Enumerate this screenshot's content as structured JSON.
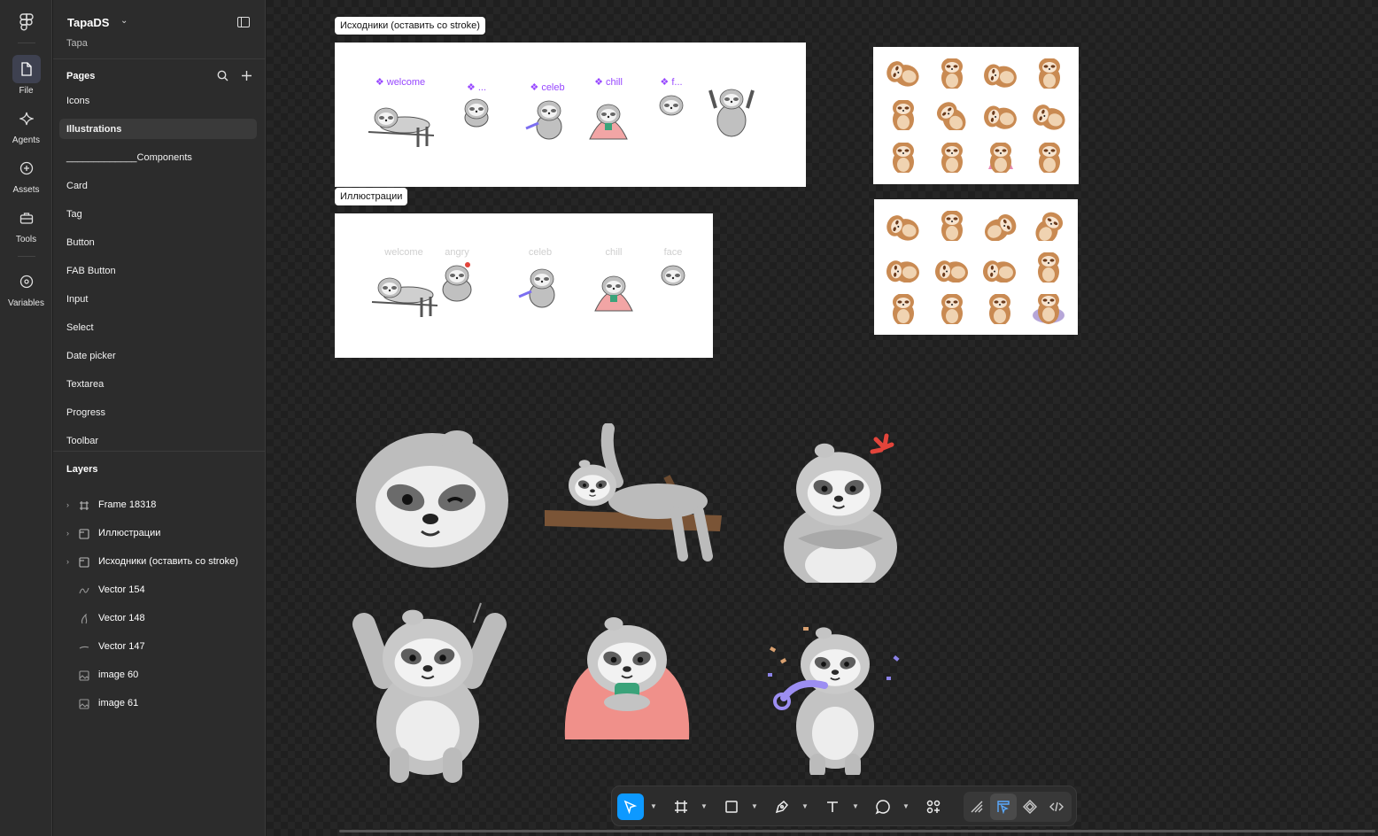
{
  "rail": {
    "items": [
      {
        "label": "File",
        "icon": "file-icon"
      },
      {
        "label": "Agents",
        "icon": "sparkle-icon"
      },
      {
        "label": "Assets",
        "icon": "plus-circle-icon"
      },
      {
        "label": "Tools",
        "icon": "toolbox-icon"
      },
      {
        "label": "Variables",
        "icon": "variables-icon"
      }
    ]
  },
  "project": {
    "title": "TapaDS",
    "subtitle": "Tapa"
  },
  "pages": {
    "title": "Pages",
    "items": [
      "Icons",
      "Illustrations",
      "_____________Components",
      "Card",
      "Tag",
      "Button",
      "FAB Button",
      "Input",
      "Select",
      "Date picker",
      "Textarea",
      "Progress",
      "Toolbar"
    ],
    "selected": "Illustrations"
  },
  "layers": {
    "title": "Layers",
    "items": [
      {
        "name": "Frame 18318",
        "type": "frame",
        "expandable": true
      },
      {
        "name": "Иллюстрации",
        "type": "section",
        "expandable": true
      },
      {
        "name": "Исходники (оставить со stroke)",
        "type": "section",
        "expandable": true
      },
      {
        "name": "Vector 154",
        "type": "vector",
        "expandable": false
      },
      {
        "name": "Vector 148",
        "type": "vector",
        "expandable": false
      },
      {
        "name": "Vector 147",
        "type": "vector",
        "expandable": false
      },
      {
        "name": "image 60",
        "type": "image",
        "expandable": false
      },
      {
        "name": "image 61",
        "type": "image",
        "expandable": false
      }
    ]
  },
  "canvas": {
    "frame_sources": {
      "label": "Исходники (оставить со stroke)",
      "items": [
        "welcome",
        "...",
        "celeb",
        "chill",
        "f...",
        ""
      ]
    },
    "frame_illustrations": {
      "label": "Иллюстрации",
      "items": [
        "welcome",
        "angry",
        "celeb",
        "chill",
        "face"
      ]
    }
  },
  "colors": {
    "accent": "#0d99ff",
    "component": "#9747ff",
    "canvas_bg": "#1f1f1f",
    "panel_bg": "#2c2c2c"
  }
}
